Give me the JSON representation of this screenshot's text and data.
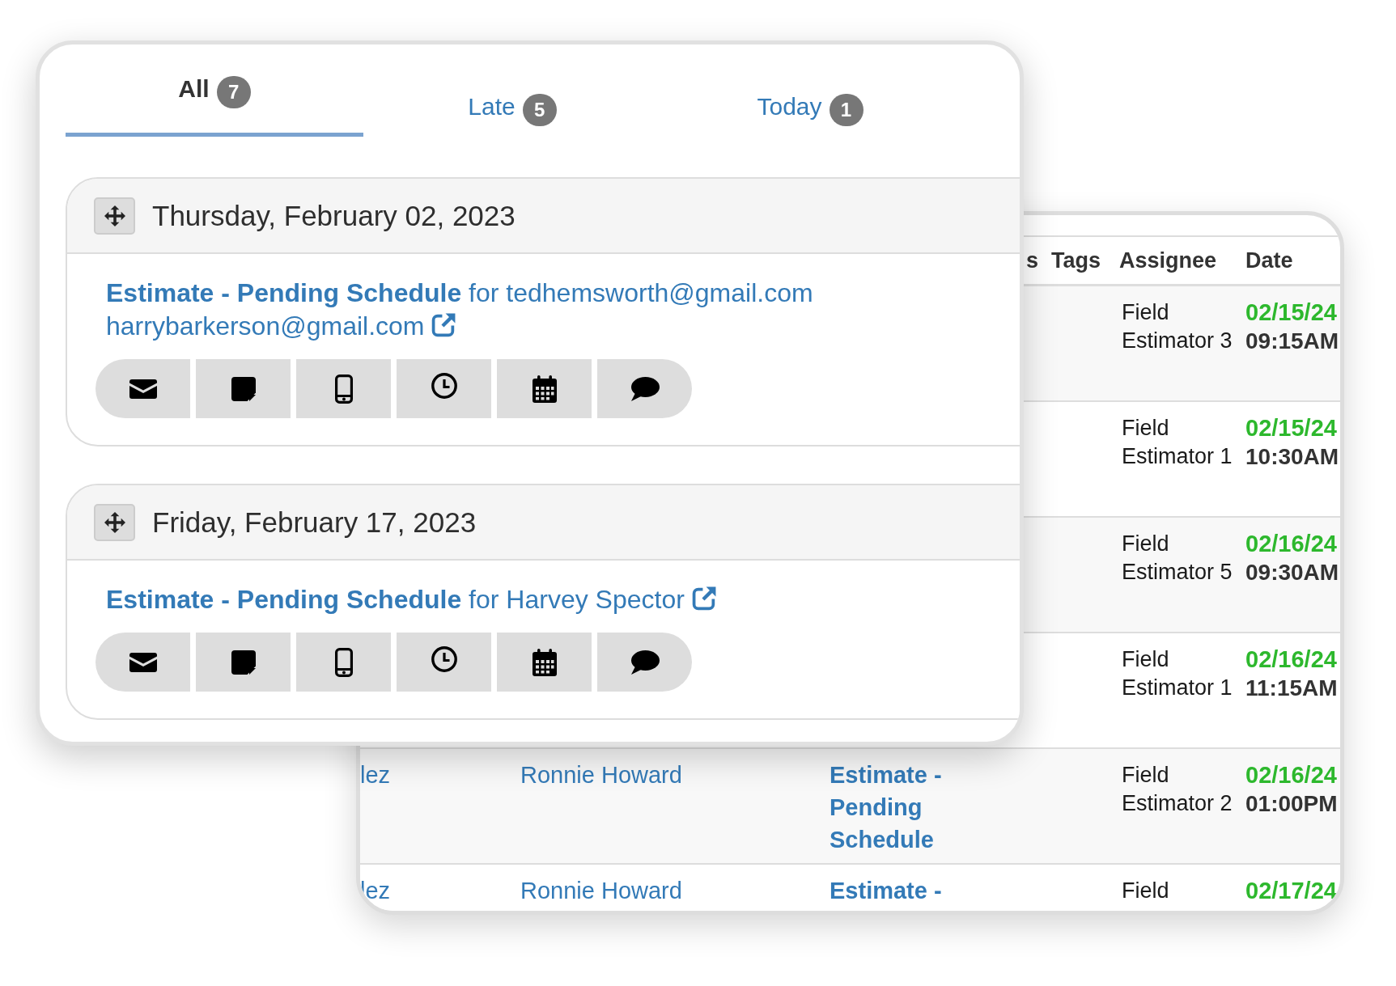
{
  "tabs": [
    {
      "label": "All",
      "count": "7",
      "selected": true
    },
    {
      "label": "Late",
      "count": "5",
      "selected": false
    },
    {
      "label": "Today",
      "count": "1",
      "selected": false
    }
  ],
  "groups": [
    {
      "date": "Thursday, February 02, 2023",
      "task": "**Estimate - Pending Schedule** for tedhemsworth@gmail.com harrybarkerson@gmail.com",
      "actions": [
        {
          "kind": "email"
        },
        {
          "kind": "note"
        },
        {
          "kind": "phone"
        },
        {
          "kind": "clock"
        },
        {
          "kind": "calendar"
        },
        {
          "kind": "chat"
        }
      ]
    },
    {
      "date": "Friday, February 17, 2023",
      "task": "**Estimate - Pending Schedule** for Harvey Spector",
      "actions": [
        {
          "kind": "email"
        },
        {
          "kind": "note"
        },
        {
          "kind": "phone"
        },
        {
          "kind": "clock"
        },
        {
          "kind": "calendar"
        },
        {
          "kind": "chat"
        }
      ]
    }
  ],
  "table": {
    "columns": [
      {
        "label": "s"
      },
      {
        "label": "Tags"
      },
      {
        "label": "Assignee"
      },
      {
        "label": "Date"
      }
    ],
    "rows": [
      {
        "assignee": "Field Estimator 3",
        "date": "02/15/24",
        "time": "09:15AM"
      },
      {
        "assignee": "Field Estimator 1",
        "date": "02/15/24",
        "time": "10:30AM"
      },
      {
        "assignee": "Field Estimator 5",
        "date": "02/16/24",
        "time": "09:30AM"
      },
      {
        "assignee": "Field Estimator 1",
        "date": "02/16/24",
        "time": "11:15AM"
      },
      {
        "column_1": "lez",
        "column_2": "Ronnie Howard",
        "column_3": "Estimate - Pending Schedule",
        "assignee": "Field Estimator 2",
        "date": "02/16/24",
        "time": "01:00PM"
      },
      {
        "column_1": "lez",
        "column_2": "Ronnie Howard",
        "column_3": "Estimate -",
        "assignee": "Field",
        "date": "02/17/24"
      }
    ]
  }
}
